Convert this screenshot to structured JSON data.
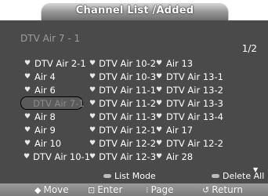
{
  "title": "Channel List /Added",
  "current_channel": "DTV Air 7 - 1",
  "page": "1/2",
  "channels": [
    {
      "label": "DTV Air 2-1",
      "selected": false
    },
    {
      "label": "Air 4",
      "selected": false
    },
    {
      "label": "Air 6",
      "selected": false
    },
    {
      "label": "DTV Air 7-1",
      "selected": true
    },
    {
      "label": "Air 8",
      "selected": false
    },
    {
      "label": "Air 9",
      "selected": false
    },
    {
      "label": "Air 10",
      "selected": false
    },
    {
      "label": "DTV Air 10-1",
      "selected": false
    },
    {
      "label": "DTV Air 10-2",
      "selected": false
    },
    {
      "label": "DTV Air 10-3",
      "selected": false
    },
    {
      "label": "DTV Air 11-1",
      "selected": false
    },
    {
      "label": "DTV Air 11-2",
      "selected": false
    },
    {
      "label": "DTV Air 11-3",
      "selected": false
    },
    {
      "label": "DTV Air 12-1",
      "selected": false
    },
    {
      "label": "DTV Air 12-2",
      "selected": false
    },
    {
      "label": "DTV Air 12-3",
      "selected": false
    },
    {
      "label": "Air 13",
      "selected": false
    },
    {
      "label": "DTV Air 13-1",
      "selected": false
    },
    {
      "label": "DTV Air 13-2",
      "selected": false
    },
    {
      "label": "DTV Air 13-3",
      "selected": false
    },
    {
      "label": "DTV Air 13-4",
      "selected": false
    },
    {
      "label": "Air 17",
      "selected": false
    },
    {
      "label": "DTV Air 12-2",
      "selected": false
    },
    {
      "label": "Air 28",
      "selected": false
    }
  ],
  "sub_functions": {
    "list_mode": "List Mode",
    "delete_all": "Delete All"
  },
  "nav": {
    "move": "Move",
    "enter": "Enter",
    "page": "Page",
    "return": "Return"
  },
  "icons": {
    "channel_marker": "heart-icon",
    "scroll_down": "triangle-down-icon"
  }
}
